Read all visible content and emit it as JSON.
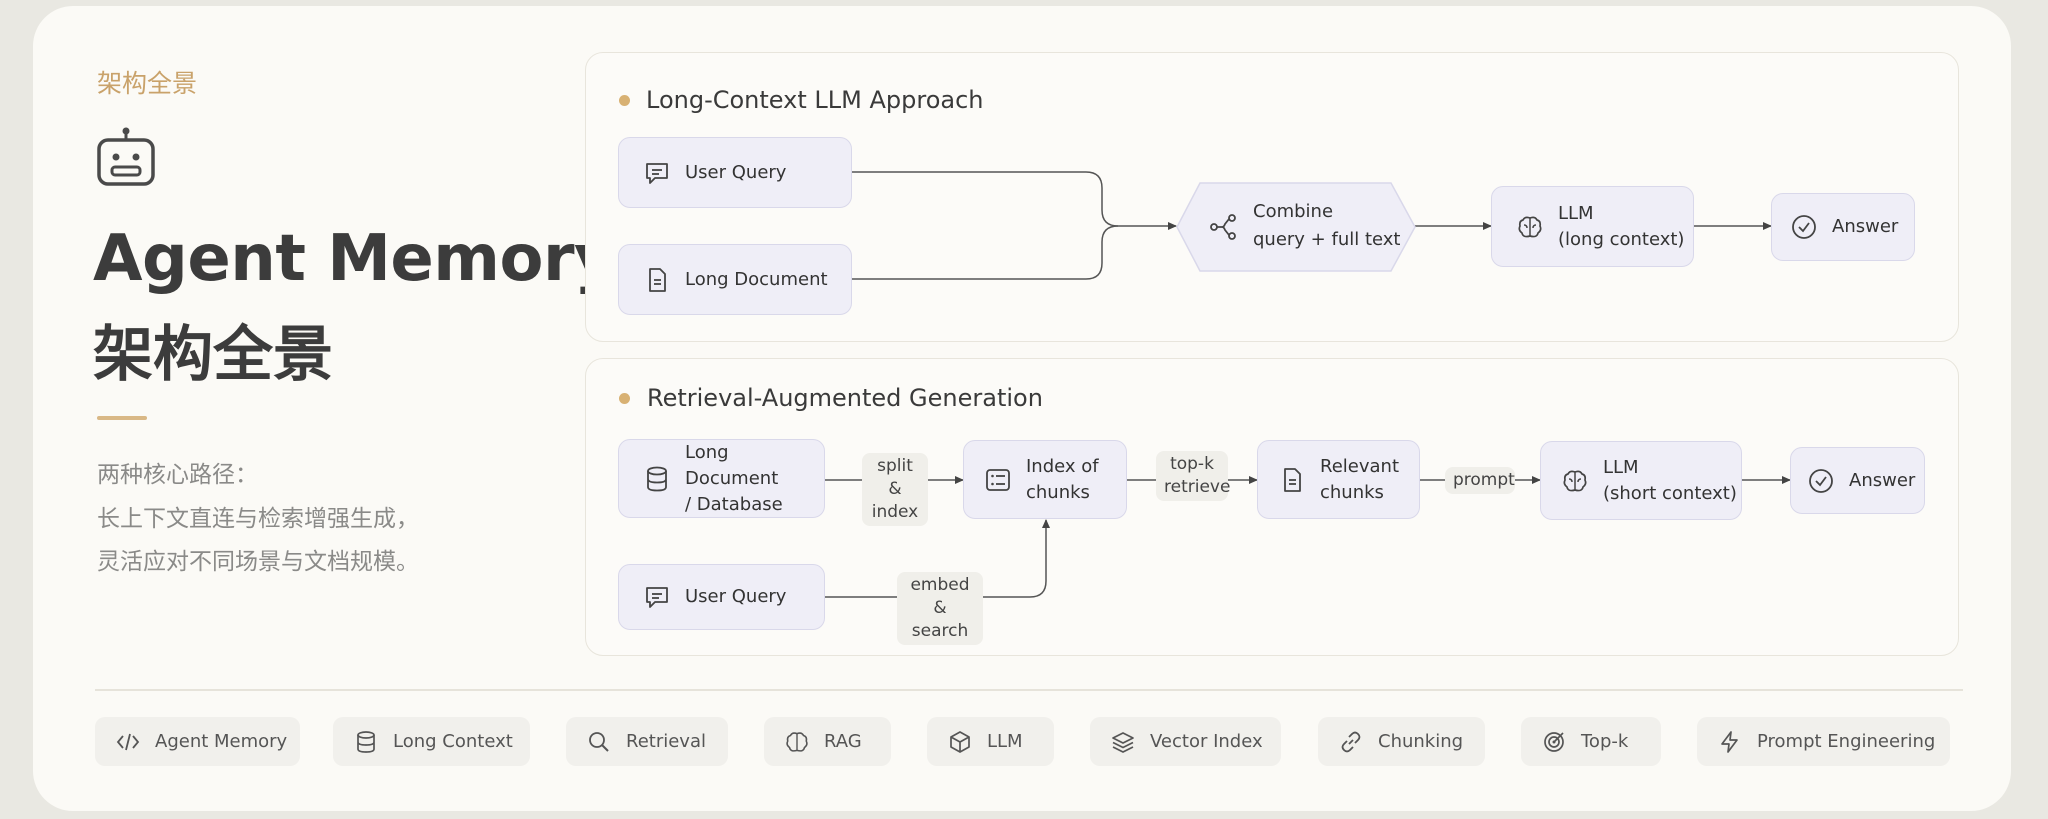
{
  "kicker": "架构全景",
  "title_en": "Agent Memory",
  "title_zh": "架构全景",
  "description": [
    "两种核心路径：",
    "长上下文直连与检索增强生成，",
    "灵活应对不同场景与文档规模。"
  ],
  "section1": {
    "title": "Long-Context LLM Approach",
    "user_query": "User Query",
    "long_document": "Long Document",
    "combine_line1": "Combine",
    "combine_line2": "query + full text",
    "llm_line1": "LLM",
    "llm_line2": "(long context)",
    "answer": "Answer"
  },
  "section2": {
    "title": "Retrieval-Augmented Generation",
    "db_line1": "Long Document",
    "db_line2": "/ Database",
    "split_line1": "split &",
    "split_line2": "index",
    "index_line1": "Index of",
    "index_line2": "chunks",
    "topk_line1": "top-k",
    "topk_line2": "retrieve",
    "relevant_line1": "Relevant",
    "relevant_line2": "chunks",
    "prompt": "prompt",
    "llm_line1": "LLM",
    "llm_line2": "(short context)",
    "answer": "Answer",
    "user_query": "User Query",
    "embed_line1": "embed &",
    "embed_line2": "search"
  },
  "tags": [
    "Agent Memory",
    "Long Context",
    "Retrieval",
    "RAG",
    "LLM",
    "Vector Index",
    "Chunking",
    "Top-k",
    "Prompt Engineering"
  ],
  "icons": [
    "robot-icon",
    "chat-icon",
    "document-icon",
    "branch-icon",
    "brain-icon",
    "check-circle-icon",
    "database-icon",
    "list-icon",
    "code-icon",
    "search-icon",
    "cube-icon",
    "layers-icon",
    "link-icon",
    "target-icon",
    "bolt-icon"
  ],
  "colors": {
    "accent": "#d8b173",
    "node_fill": "#efeef7",
    "node_border": "#d9d8ea",
    "card": "#fbfaf6"
  }
}
